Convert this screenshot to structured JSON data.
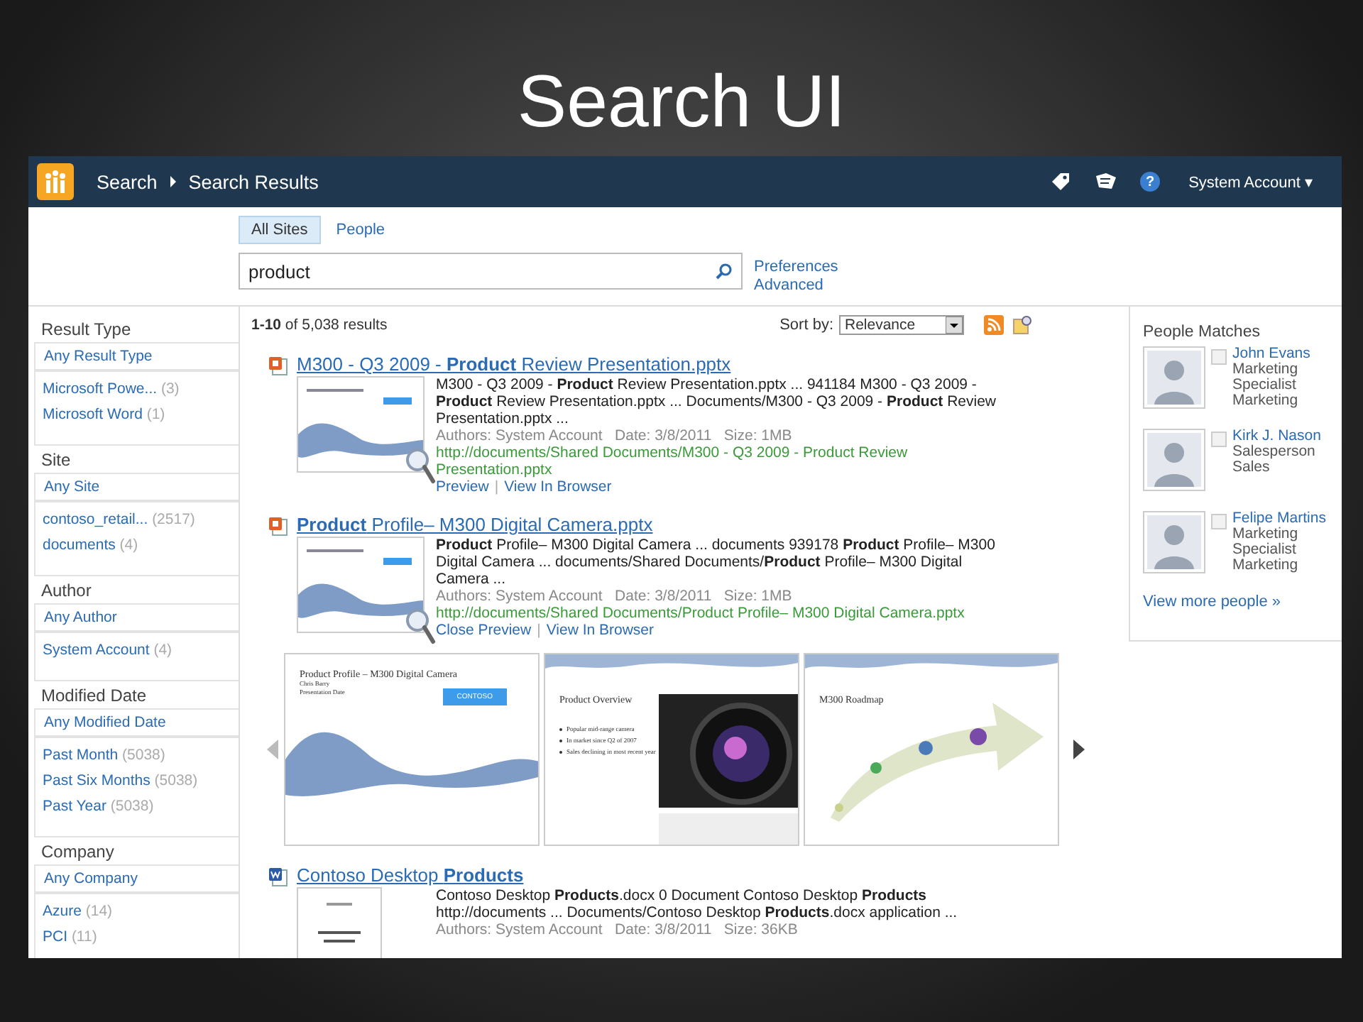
{
  "slide_title": "Search UI",
  "topbar": {
    "breadcrumb": [
      "Search",
      "Search Results"
    ],
    "user": "System Account",
    "user_caret": "▾",
    "help": "?"
  },
  "scopes": [
    {
      "label": "All Sites",
      "selected": true
    },
    {
      "label": "People",
      "selected": false
    }
  ],
  "search": {
    "value": "product"
  },
  "search_links": [
    "Preferences",
    "Advanced"
  ],
  "refiners": [
    {
      "title": "Result Type",
      "items": [
        {
          "label": "Any Result Type",
          "selected": true
        },
        {
          "label": "Microsoft Powe...",
          "count": "(3)",
          "selected": false
        },
        {
          "label": "Microsoft Word",
          "count": "(1)",
          "selected": false
        }
      ]
    },
    {
      "title": "Site",
      "items": [
        {
          "label": "Any Site",
          "selected": true
        },
        {
          "label": "contoso_retail...",
          "count": "(2517)",
          "selected": false
        },
        {
          "label": "documents",
          "count": "(4)",
          "selected": false
        }
      ]
    },
    {
      "title": "Author",
      "items": [
        {
          "label": "Any Author",
          "selected": true
        },
        {
          "label": "System Account",
          "count": "(4)",
          "selected": false
        }
      ]
    },
    {
      "title": "Modified Date",
      "items": [
        {
          "label": "Any Modified Date",
          "selected": true
        },
        {
          "label": "Past Month",
          "count": "(5038)",
          "selected": false
        },
        {
          "label": "Past Six Months",
          "count": "(5038)",
          "selected": false
        },
        {
          "label": "Past Year",
          "count": "(5038)",
          "selected": false
        }
      ]
    },
    {
      "title": "Company",
      "items": [
        {
          "label": "Any Company",
          "selected": true
        },
        {
          "label": "Azure",
          "count": "(14)",
          "selected": false
        },
        {
          "label": "PCI",
          "count": "(11)",
          "selected": false
        }
      ]
    }
  ],
  "results_summary": "**1-10** of 5,038 results",
  "sort": {
    "label": "Sort by:",
    "value": "Relevance"
  },
  "results": [
    {
      "kind": "pptx",
      "title": "M300 - Q3 2009 - **Product** Review Presentation.pptx",
      "summary": "M300 - Q3 2009 - **Product** Review Presentation.pptx ... 941184 M300 - Q3 2009 - **Product** Review Presentation.pptx ... Documents/M300 - Q3 2009 - **Product** Review Presentation.pptx ...",
      "meta": "Authors: System Account   Date: 3/8/2011   Size: 1MB",
      "url": "http://documents/Shared Documents/M300 - Q3 2009 - Product Review Presentation.pptx",
      "actions": [
        "Preview",
        "View In Browser"
      ],
      "separator": "|"
    },
    {
      "kind": "pptx",
      "title": "**Product** Profile– M300 Digital Camera.pptx",
      "summary": "**Product** Profile– M300 Digital Camera ... documents 939178 **Product** Profile– M300 Digital Camera ... documents/Shared Documents/**Product** Profile– M300 Digital Camera ...",
      "meta": "Authors: System Account   Date: 3/8/2011   Size: 1MB",
      "url": "http://documents/Shared Documents/Product Profile– M300 Digital Camera.pptx",
      "actions": [
        "Close Preview",
        "View In Browser"
      ],
      "separator": "|",
      "preview": [
        {
          "kind": "title",
          "title": "Product Profile – M300 Digital Camera",
          "lines": [
            "Chris Barry",
            "Presentation Date"
          ],
          "badge": "CONTOSO"
        },
        {
          "kind": "bullets",
          "title": "Product Overview",
          "lines": [
            "Popular mid-range camera",
            "In market since Q2 of 2007",
            "Sales declining in most recent year"
          ]
        },
        {
          "kind": "roadmap",
          "title": "M300 Roadmap"
        }
      ]
    },
    {
      "kind": "docx",
      "title": "Contoso Desktop **Products**",
      "summary": "Contoso Desktop **Products**.docx 0 Document Contoso Desktop **Products** http://documents ... Documents/Contoso Desktop **Products**.docx application ...",
      "meta": "Authors: System Account   Date: 3/8/2011   Size: 36KB"
    }
  ],
  "people": {
    "title": "People Matches",
    "items": [
      {
        "name": "John Evans",
        "lines": [
          "Marketing Specialist",
          "Marketing"
        ],
        "checked": false
      },
      {
        "name": "Kirk J. Nason",
        "lines": [
          "Salesperson",
          "Sales"
        ],
        "checked": false
      },
      {
        "name": "Felipe Martins",
        "lines": [
          "Marketing Specialist",
          "Marketing"
        ],
        "checked": false
      }
    ],
    "more": "View more people »"
  }
}
